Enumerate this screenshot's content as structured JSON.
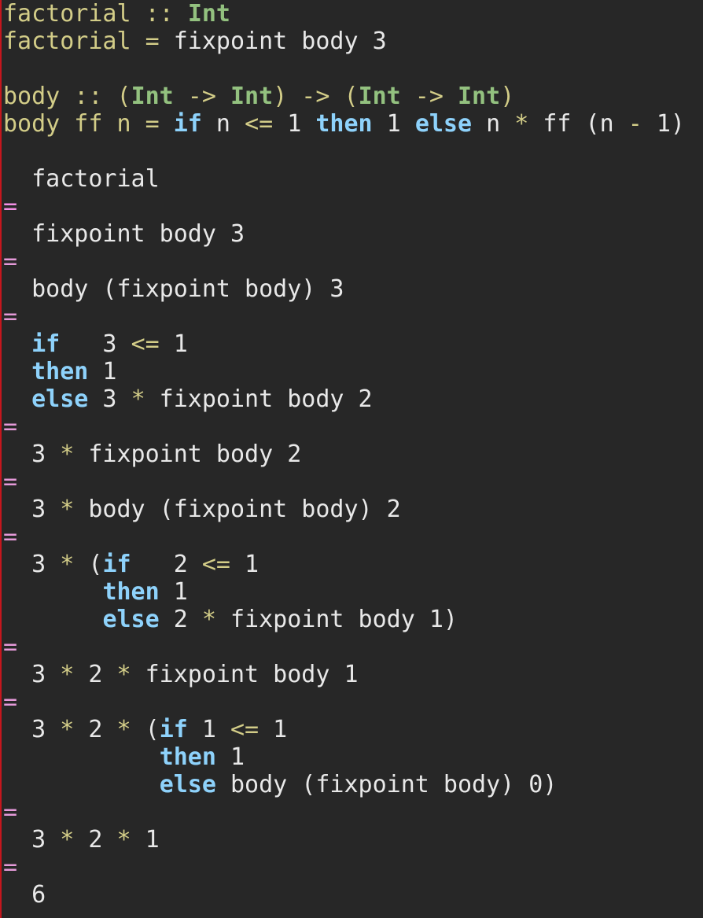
{
  "colors": {
    "background": "#272727",
    "gutter_border": "#c5161d",
    "definition": "#d3cd88",
    "type": "#93c17f",
    "keyword": "#8ed2fb",
    "operator": "#d3cd88",
    "text": "#e8e8e8",
    "equals_marker": "#e59ad9"
  },
  "editor": {
    "lines": [
      [
        {
          "t": "factorial :: ",
          "c": "def"
        },
        {
          "t": "Int",
          "c": "type"
        }
      ],
      [
        {
          "t": "factorial = ",
          "c": "def"
        },
        {
          "t": "fixpoint body 3",
          "c": "plain"
        }
      ],
      [],
      [
        {
          "t": "body :: (",
          "c": "def"
        },
        {
          "t": "Int",
          "c": "type"
        },
        {
          "t": " -> ",
          "c": "def"
        },
        {
          "t": "Int",
          "c": "type"
        },
        {
          "t": ") -> (",
          "c": "def"
        },
        {
          "t": "Int",
          "c": "type"
        },
        {
          "t": " -> ",
          "c": "def"
        },
        {
          "t": "Int",
          "c": "type"
        },
        {
          "t": ")",
          "c": "def"
        }
      ],
      [
        {
          "t": "body ff n = ",
          "c": "def"
        },
        {
          "t": "if",
          "c": "kw"
        },
        {
          "t": " n ",
          "c": "plain"
        },
        {
          "t": "<=",
          "c": "op"
        },
        {
          "t": " 1 ",
          "c": "plain"
        },
        {
          "t": "then",
          "c": "kw"
        },
        {
          "t": " 1 ",
          "c": "plain"
        },
        {
          "t": "else",
          "c": "kw"
        },
        {
          "t": " n ",
          "c": "plain"
        },
        {
          "t": "*",
          "c": "op"
        },
        {
          "t": " ff (n ",
          "c": "plain"
        },
        {
          "t": "-",
          "c": "op"
        },
        {
          "t": " 1)",
          "c": "plain"
        }
      ],
      [],
      [
        {
          "t": "  factorial",
          "c": "plain"
        }
      ],
      [
        {
          "t": "=",
          "c": "eqsign"
        }
      ],
      [
        {
          "t": "  fixpoint body 3",
          "c": "plain"
        }
      ],
      [
        {
          "t": "=",
          "c": "eqsign"
        }
      ],
      [
        {
          "t": "  body (fixpoint body) 3",
          "c": "plain"
        }
      ],
      [
        {
          "t": "=",
          "c": "eqsign"
        }
      ],
      [
        {
          "t": "  ",
          "c": "plain"
        },
        {
          "t": "if",
          "c": "kw"
        },
        {
          "t": "   3 ",
          "c": "plain"
        },
        {
          "t": "<=",
          "c": "op"
        },
        {
          "t": " 1",
          "c": "plain"
        }
      ],
      [
        {
          "t": "  ",
          "c": "plain"
        },
        {
          "t": "then",
          "c": "kw"
        },
        {
          "t": " 1",
          "c": "plain"
        }
      ],
      [
        {
          "t": "  ",
          "c": "plain"
        },
        {
          "t": "else",
          "c": "kw"
        },
        {
          "t": " 3 ",
          "c": "plain"
        },
        {
          "t": "*",
          "c": "op"
        },
        {
          "t": " fixpoint body 2",
          "c": "plain"
        }
      ],
      [
        {
          "t": "=",
          "c": "eqsign"
        }
      ],
      [
        {
          "t": "  3 ",
          "c": "plain"
        },
        {
          "t": "*",
          "c": "op"
        },
        {
          "t": " fixpoint body 2",
          "c": "plain"
        }
      ],
      [
        {
          "t": "=",
          "c": "eqsign"
        }
      ],
      [
        {
          "t": "  3 ",
          "c": "plain"
        },
        {
          "t": "*",
          "c": "op"
        },
        {
          "t": " body (fixpoint body) 2",
          "c": "plain"
        }
      ],
      [
        {
          "t": "=",
          "c": "eqsign"
        }
      ],
      [
        {
          "t": "  3 ",
          "c": "plain"
        },
        {
          "t": "*",
          "c": "op"
        },
        {
          "t": " (",
          "c": "plain"
        },
        {
          "t": "if",
          "c": "kw"
        },
        {
          "t": "   2 ",
          "c": "plain"
        },
        {
          "t": "<=",
          "c": "op"
        },
        {
          "t": " 1",
          "c": "plain"
        }
      ],
      [
        {
          "t": "       ",
          "c": "plain"
        },
        {
          "t": "then",
          "c": "kw"
        },
        {
          "t": " 1",
          "c": "plain"
        }
      ],
      [
        {
          "t": "       ",
          "c": "plain"
        },
        {
          "t": "else",
          "c": "kw"
        },
        {
          "t": " 2 ",
          "c": "plain"
        },
        {
          "t": "*",
          "c": "op"
        },
        {
          "t": " fixpoint body 1)",
          "c": "plain"
        }
      ],
      [
        {
          "t": "=",
          "c": "eqsign"
        }
      ],
      [
        {
          "t": "  3 ",
          "c": "plain"
        },
        {
          "t": "*",
          "c": "op"
        },
        {
          "t": " 2 ",
          "c": "plain"
        },
        {
          "t": "*",
          "c": "op"
        },
        {
          "t": " fixpoint body 1",
          "c": "plain"
        }
      ],
      [
        {
          "t": "=",
          "c": "eqsign"
        }
      ],
      [
        {
          "t": "  3 ",
          "c": "plain"
        },
        {
          "t": "*",
          "c": "op"
        },
        {
          "t": " 2 ",
          "c": "plain"
        },
        {
          "t": "*",
          "c": "op"
        },
        {
          "t": " (",
          "c": "plain"
        },
        {
          "t": "if",
          "c": "kw"
        },
        {
          "t": " 1 ",
          "c": "plain"
        },
        {
          "t": "<=",
          "c": "op"
        },
        {
          "t": " 1",
          "c": "plain"
        }
      ],
      [
        {
          "t": "           ",
          "c": "plain"
        },
        {
          "t": "then",
          "c": "kw"
        },
        {
          "t": " 1",
          "c": "plain"
        }
      ],
      [
        {
          "t": "           ",
          "c": "plain"
        },
        {
          "t": "else",
          "c": "kw"
        },
        {
          "t": " body (fixpoint body) 0)",
          "c": "plain"
        }
      ],
      [
        {
          "t": "=",
          "c": "eqsign"
        }
      ],
      [
        {
          "t": "  3 ",
          "c": "plain"
        },
        {
          "t": "*",
          "c": "op"
        },
        {
          "t": " 2 ",
          "c": "plain"
        },
        {
          "t": "*",
          "c": "op"
        },
        {
          "t": " 1",
          "c": "plain"
        }
      ],
      [
        {
          "t": "=",
          "c": "eqsign"
        }
      ],
      [
        {
          "t": "  6",
          "c": "plain"
        }
      ]
    ]
  }
}
